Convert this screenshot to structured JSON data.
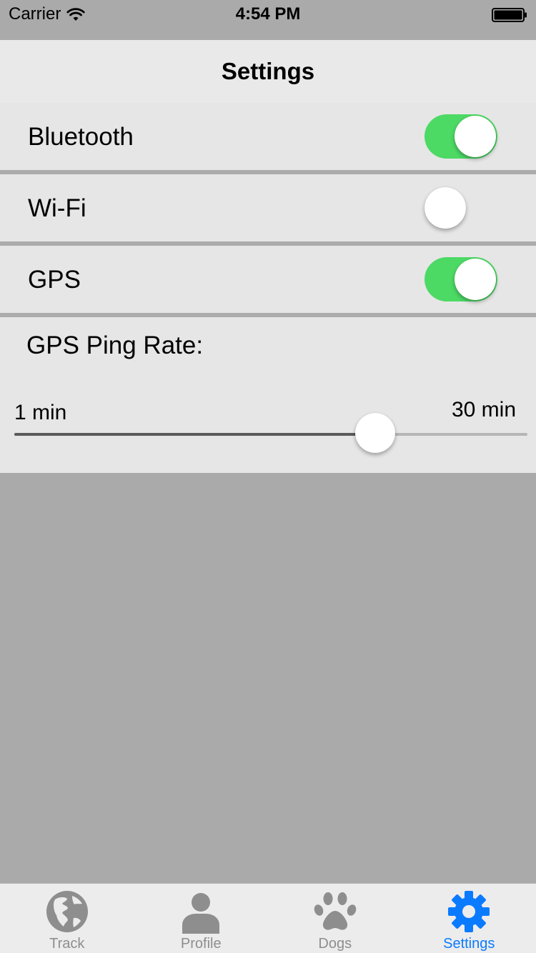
{
  "status_bar": {
    "carrier": "Carrier",
    "time": "4:54 PM"
  },
  "nav": {
    "title": "Settings"
  },
  "settings": [
    {
      "label": "Bluetooth",
      "on": true
    },
    {
      "label": "Wi-Fi",
      "on": false
    },
    {
      "label": "GPS",
      "on": true
    }
  ],
  "ping_rate": {
    "label": "GPS Ping Rate:",
    "min_label": "1 min",
    "max_label": "30 min",
    "fraction": 0.72
  },
  "tabs": [
    {
      "label": "Track",
      "icon": "globe-icon",
      "active": false
    },
    {
      "label": "Profile",
      "icon": "person-icon",
      "active": false
    },
    {
      "label": "Dogs",
      "icon": "paw-icon",
      "active": false
    },
    {
      "label": "Settings",
      "icon": "gear-icon",
      "active": true
    }
  ],
  "colors": {
    "switch_on": "#4cd964",
    "tab_active": "#0a7bff",
    "tab_inactive": "#8e8e8e"
  }
}
